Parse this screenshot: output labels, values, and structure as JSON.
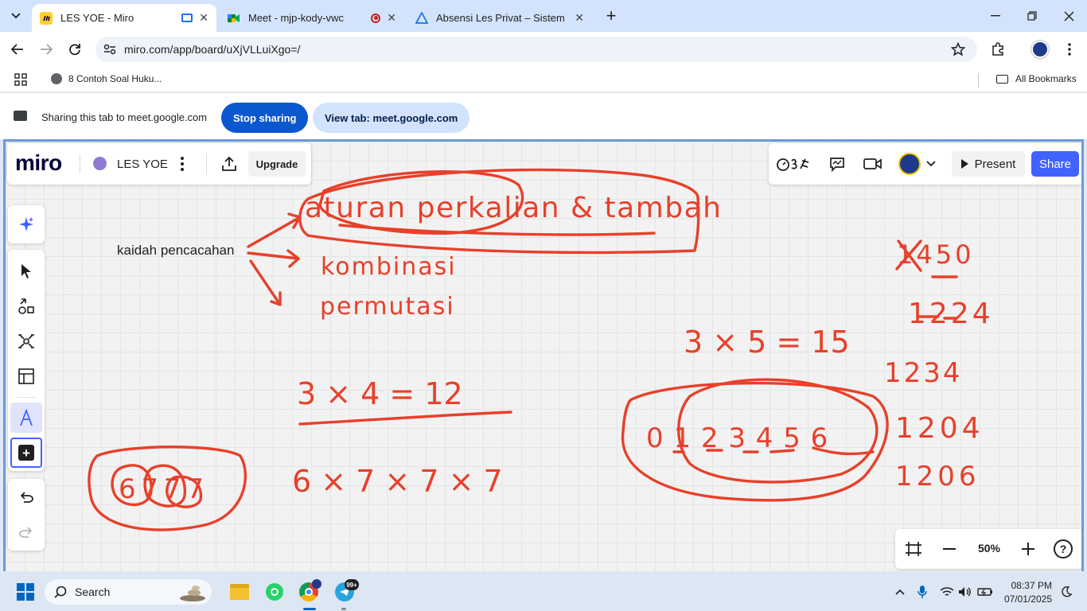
{
  "browser": {
    "tabs": [
      {
        "title": "LES YOE - Miro",
        "close": "✕"
      },
      {
        "title": "Meet - mjp-kody-vwc",
        "close": "✕"
      },
      {
        "title": "Absensi Les Privat – Sistem Ruang",
        "close": "✕"
      }
    ],
    "new_tab": "+",
    "url": "miro.com/app/board/uXjVLLuiXgo=/",
    "bookmark_item": "8 Contoh Soal Huku...",
    "all_bookmarks": "All Bookmarks"
  },
  "sharing": {
    "message": "Sharing this tab to meet.google.com",
    "stop_label": "Stop sharing",
    "view_label": "View tab: meet.google.com"
  },
  "miro": {
    "logo": "miro",
    "board_name": "LES YOE",
    "upgrade_label": "Upgrade",
    "present_label": "Present",
    "share_label": "Share",
    "zoom": "50%",
    "help": "?",
    "accent": "#4262ff"
  },
  "canvas": {
    "sticky_text": "kaidah pencacahan",
    "ink": {
      "aturan": "aturan perkalian & tambah",
      "kombinasi": "kombinasi",
      "permutasi": "permutasi",
      "eq1": "3 × 5 = 15",
      "eq2": "3 × 4 = 12",
      "eq3": "6 × 7 × 7 × 7",
      "nums": "0 1 2 3 4 5 6",
      "n1": "1450",
      "n2": "1224",
      "n3": "1234",
      "n4": "1204",
      "n5": "1206",
      "n6": "6 7 7 7",
      "ink_color": "#e8402a"
    }
  },
  "taskbar": {
    "search": "Search",
    "badge": "99+",
    "time": "08:37 PM",
    "date": "07/01/2025"
  }
}
